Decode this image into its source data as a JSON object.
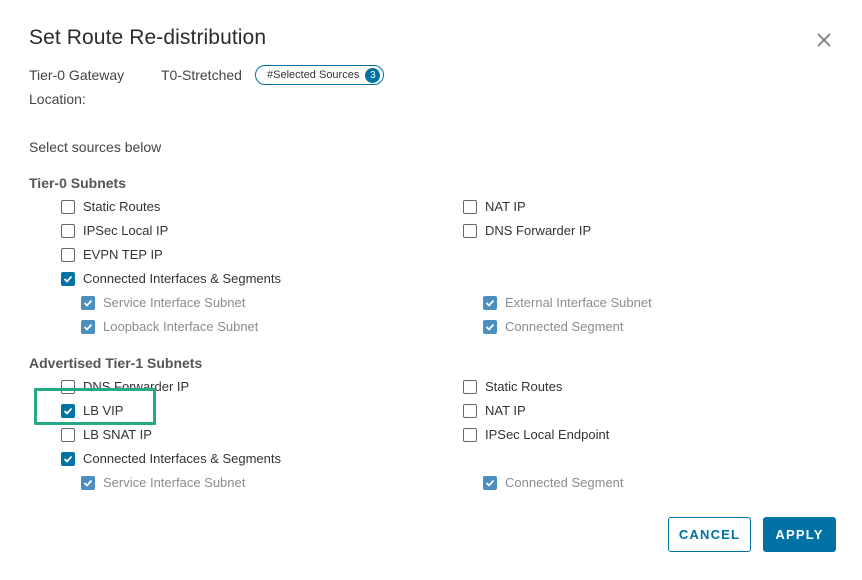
{
  "dialog": {
    "title": "Set Route Re-distribution",
    "gateway_label": "Tier-0 Gateway",
    "gateway_value": "T0-Stretched",
    "location_label": "Location:",
    "badge_label": "#Selected Sources",
    "badge_count": "3",
    "instruction": "Select sources below"
  },
  "tier0": {
    "heading": "Tier-0 Subnets",
    "static_routes": "Static Routes",
    "ipsec_local_ip": "IPSec Local IP",
    "evpn_tep_ip": "EVPN TEP IP",
    "connected": "Connected Interfaces & Segments",
    "service_interface_subnet": "Service Interface Subnet",
    "loopback_interface_subnet": "Loopback Interface Subnet",
    "nat_ip": "NAT IP",
    "dns_forwarder_ip": "DNS Forwarder IP",
    "external_interface_subnet": "External Interface Subnet",
    "connected_segment": "Connected Segment"
  },
  "tier1": {
    "heading": "Advertised Tier-1 Subnets",
    "dns_forwarder_ip": "DNS Forwarder IP",
    "lb_vip": "LB VIP",
    "lb_snat_ip": "LB SNAT IP",
    "connected": "Connected Interfaces & Segments",
    "service_interface_subnet": "Service Interface Subnet",
    "static_routes": "Static Routes",
    "nat_ip": "NAT IP",
    "ipsec_local_endpoint": "IPSec Local Endpoint",
    "connected_segment": "Connected Segment"
  },
  "buttons": {
    "cancel": "CANCEL",
    "apply": "APPLY"
  },
  "colors": {
    "accent": "#0072a3",
    "highlight": "#27a986"
  }
}
